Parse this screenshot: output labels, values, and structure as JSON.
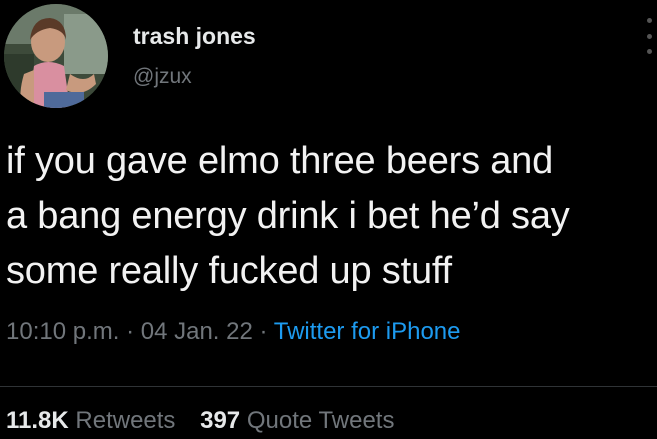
{
  "author": {
    "display_name": "trash jones",
    "handle": "@jzux"
  },
  "tweet": {
    "lines": [
      "if you gave elmo three beers and",
      "a bang energy drink i bet he’d say",
      "some really fucked up stuff"
    ],
    "time": "10:10 p.m.",
    "date": "04 Jan. 22",
    "separator": "·",
    "source": "Twitter for iPhone"
  },
  "stats": {
    "retweets_count": "11.8K",
    "retweets_label": "Retweets",
    "quotes_count": "397",
    "quotes_label": "Quote Tweets"
  },
  "colors": {
    "background": "#000000",
    "link": "#1d9bf0",
    "muted": "#71767b",
    "text": "#e7e9ea"
  },
  "icons": {
    "more": "more-options-icon"
  }
}
